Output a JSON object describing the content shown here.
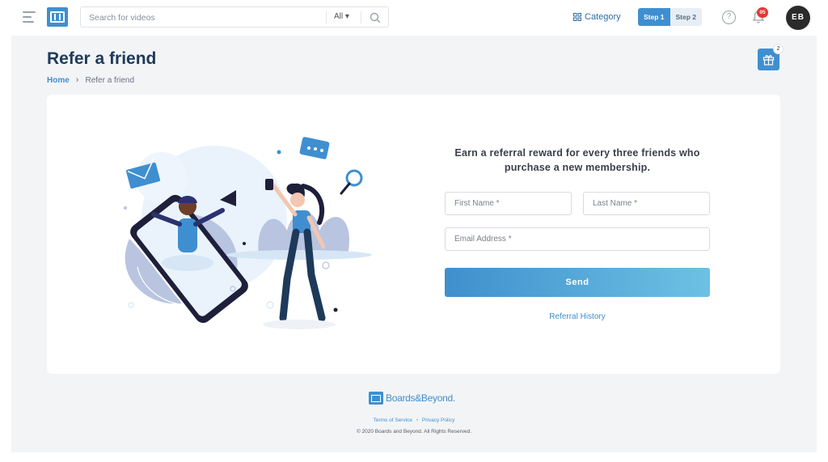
{
  "header": {
    "search": {
      "placeholder": "Search for videos",
      "filter_label": "All ▾"
    },
    "category_label": "Category",
    "steps": [
      "Step 1",
      "Step 2"
    ],
    "help_glyph": "?",
    "notification_count": "05",
    "avatar_initials": "EB"
  },
  "page": {
    "title": "Refer a friend",
    "breadcrumb": {
      "home": "Home",
      "current": "Refer a friend"
    },
    "gift_count": "2"
  },
  "form": {
    "promo_text": "Earn a referral reward for every three friends who purchase a new membership.",
    "first_name_placeholder": "First Name *",
    "last_name_placeholder": "Last Name *",
    "email_placeholder": "Email Address *",
    "send_label": "Send",
    "history_link": "Referral History"
  },
  "footer": {
    "brand": "Boards&Beyond.",
    "links": [
      "Terms of Service",
      "Privacy Policy"
    ],
    "link_separator": "•",
    "copyright": "© 2020 Boards and Beyond. All Rights Reserved."
  },
  "colors": {
    "accent": "#3f8fd0",
    "title": "#1e3a5a",
    "background": "#f3f4f6",
    "notification": "#e53935"
  }
}
